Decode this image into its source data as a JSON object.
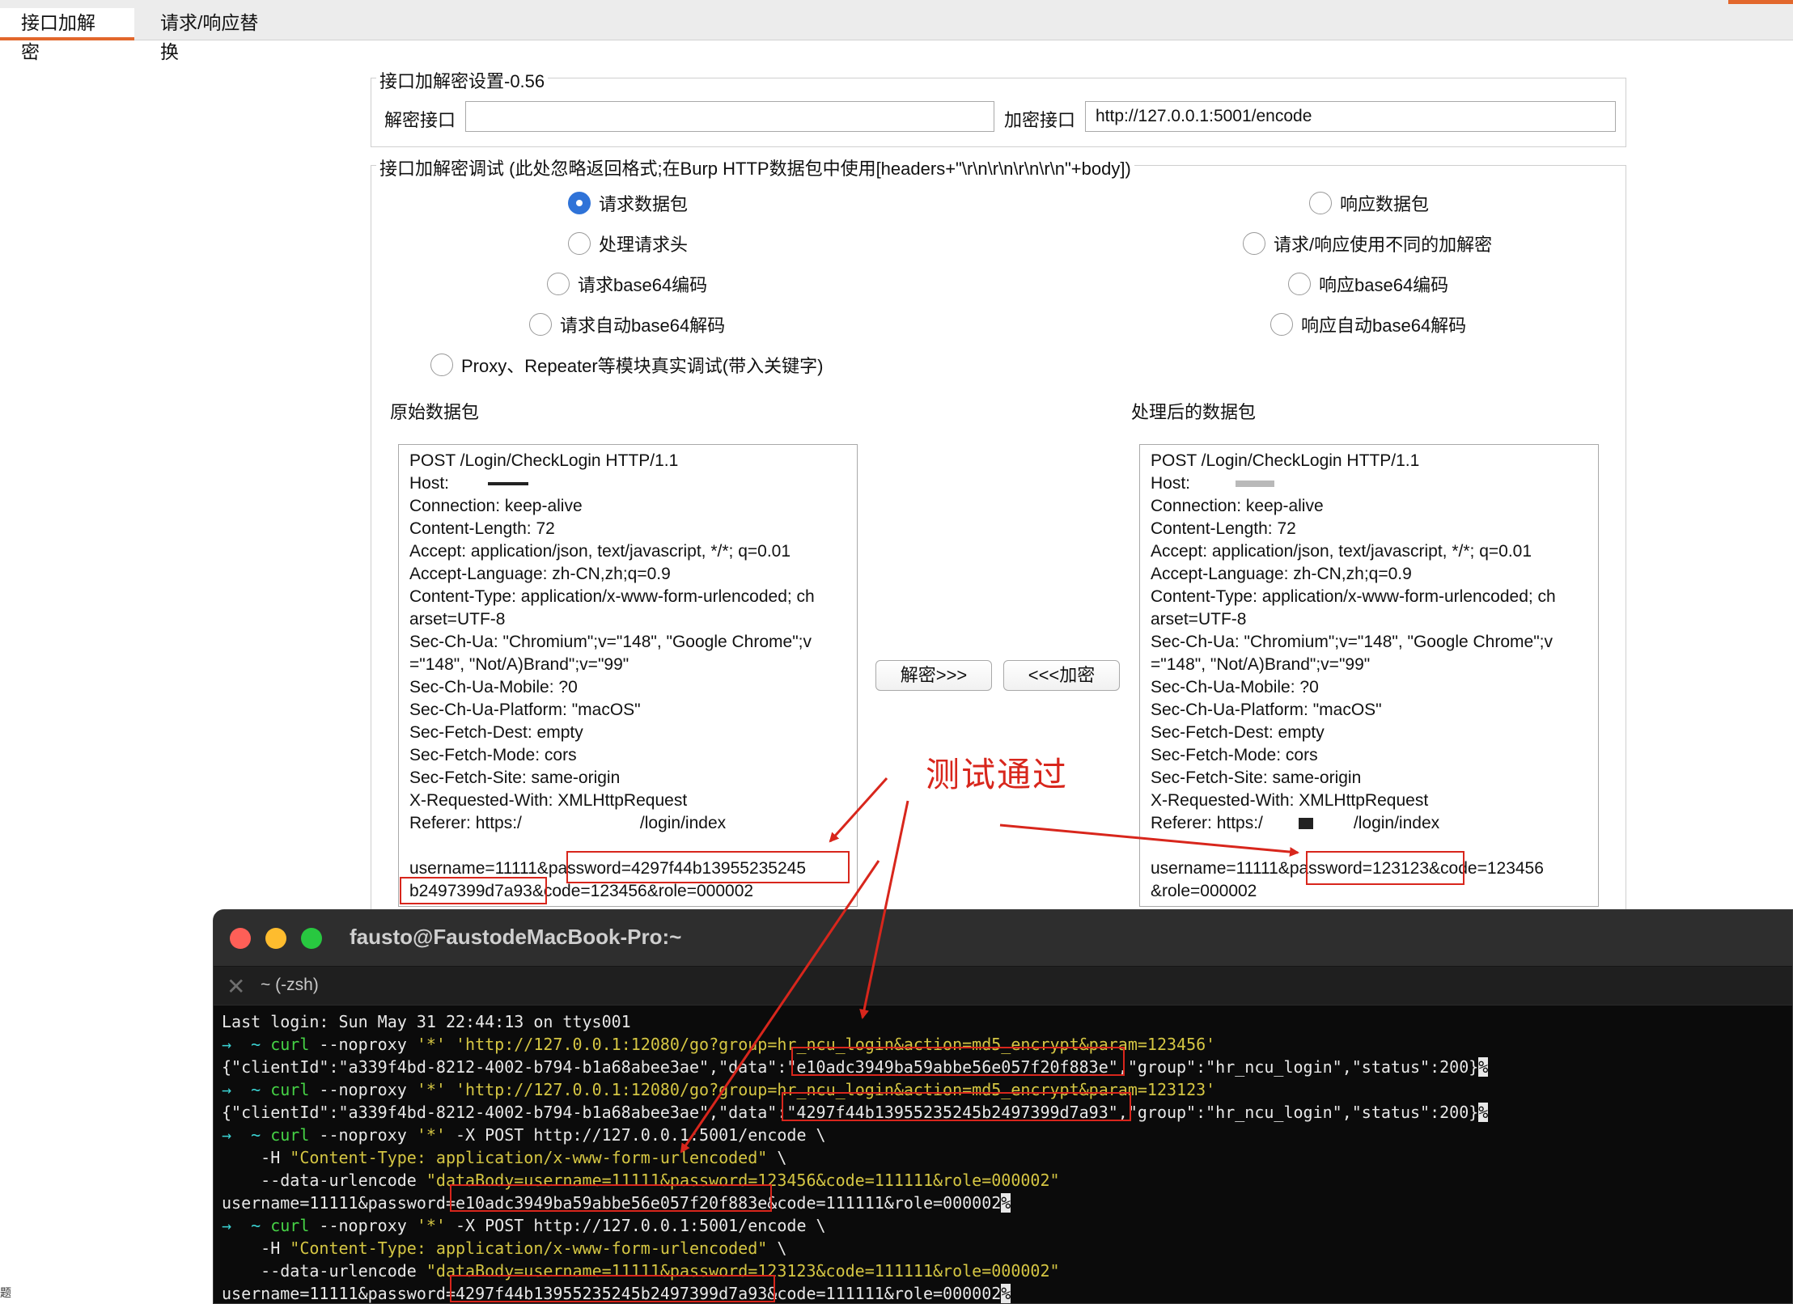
{
  "tabs": [
    {
      "label": "接口加解密",
      "active": true
    },
    {
      "label": "请求/响应替换",
      "active": false
    }
  ],
  "settings": {
    "legend": "接口加解密设置-0.56",
    "decrypt_label": "解密接口",
    "decrypt_value": "",
    "encrypt_label": "加密接口",
    "encrypt_value": "http://127.0.0.1:5001/encode"
  },
  "debug": {
    "legend": "接口加解密调试 (此处忽略返回格式;在Burp HTTP数据包中使用[headers+\"\\r\\n\\r\\n\\r\\n\\r\\n\"+body])",
    "left_radios": [
      {
        "label": "请求数据包",
        "checked": true
      },
      {
        "label": "处理请求头",
        "checked": false
      },
      {
        "label": "请求base64编码",
        "checked": false
      },
      {
        "label": "请求自动base64解码",
        "checked": false
      },
      {
        "label": "Proxy、Repeater等模块真实调试(带入关键字)",
        "checked": false
      }
    ],
    "right_radios": [
      {
        "label": "响应数据包",
        "checked": false
      },
      {
        "label": "请求/响应使用不同的加解密",
        "checked": false
      },
      {
        "label": "响应base64编码",
        "checked": false
      },
      {
        "label": "响应自动base64解码",
        "checked": false
      }
    ],
    "original_title": "原始数据包",
    "processed_title": "处理后的数据包",
    "decrypt_button": "解密>>>",
    "encrypt_button": "<<<加密"
  },
  "original_packet": [
    "POST /Login/CheckLogin HTTP/1.1",
    "Host:",
    "Connection: keep-alive",
    "Content-Length: 72",
    "Accept: application/json, text/javascript, */*; q=0.01",
    "Accept-Language: zh-CN,zh;q=0.9",
    "Content-Type: application/x-www-form-urlencoded; ch",
    "arset=UTF-8",
    "Sec-Ch-Ua: \"Chromium\";v=\"148\", \"Google Chrome\";v",
    "=\"148\", \"Not/A)Brand\";v=\"99\"",
    "Sec-Ch-Ua-Mobile: ?0",
    "Sec-Ch-Ua-Platform: \"macOS\"",
    "Sec-Fetch-Dest: empty",
    "Sec-Fetch-Mode: cors",
    "Sec-Fetch-Site: same-origin",
    "X-Requested-With: XMLHttpRequest",
    "Referer: https:/",
    "/login/index",
    "username=11111&password=4297f44b13955235245",
    "b2497399d7a93&code=123456&role=000002"
  ],
  "processed_packet": [
    "POST /Login/CheckLogin HTTP/1.1",
    "Host:",
    "Connection: keep-alive",
    "Content-Length: 72",
    "Accept: application/json, text/javascript, */*; q=0.01",
    "Accept-Language: zh-CN,zh;q=0.9",
    "Content-Type: application/x-www-form-urlencoded; ch",
    "arset=UTF-8",
    "Sec-Ch-Ua: \"Chromium\";v=\"148\", \"Google Chrome\";v",
    "=\"148\", \"Not/A)Brand\";v=\"99\"",
    "Sec-Ch-Ua-Mobile: ?0",
    "Sec-Ch-Ua-Platform: \"macOS\"",
    "Sec-Fetch-Dest: empty",
    "Sec-Fetch-Mode: cors",
    "Sec-Fetch-Site: same-origin",
    "X-Requested-With: XMLHttpRequest",
    "Referer: https:/",
    "/login/index",
    "username=11111&password=123123&code=123456",
    "&role=000002"
  ],
  "annotation": {
    "text": "测试通过",
    "color": "#d8261c"
  },
  "terminal": {
    "title": "fausto@FaustodeMacBook-Pro:~",
    "tab": "~ (-zsh)",
    "lines": [
      {
        "parts": [
          {
            "t": "Last login: Sun May 31 22:44:13 on ttys001",
            "c": "plain"
          }
        ]
      },
      {
        "parts": [
          {
            "t": "→  ~ ",
            "c": "arrow"
          },
          {
            "t": "curl",
            "c": "cmd"
          },
          {
            "t": " --noproxy ",
            "c": "plain"
          },
          {
            "t": "'*' 'http://127.0.0.1:12080/go?group=hr_ncu_login&action=md5_encrypt&param=123456'",
            "c": "str"
          }
        ]
      },
      {
        "parts": [
          {
            "t": "{\"clientId\":\"a339f4bd-8212-4002-b794-b1a68abee3ae\",\"data\":\"e10adc3949ba59abbe56e057f20f883e\",\"group\":\"hr_ncu_login\",\"status\":200}",
            "c": "plain"
          },
          {
            "t": "%",
            "c": "pct"
          }
        ]
      },
      {
        "parts": [
          {
            "t": "→  ~ ",
            "c": "arrow"
          },
          {
            "t": "curl",
            "c": "cmd"
          },
          {
            "t": " --noproxy ",
            "c": "plain"
          },
          {
            "t": "'*' 'http://127.0.0.1:12080/go?group=hr_ncu_login&action=md5_encrypt&param=123123'",
            "c": "str"
          }
        ]
      },
      {
        "parts": [
          {
            "t": "{\"clientId\":\"a339f4bd-8212-4002-b794-b1a68abee3ae\",\"data\":\"4297f44b13955235245b2497399d7a93\",\"group\":\"hr_ncu_login\",\"status\":200}",
            "c": "plain"
          },
          {
            "t": "%",
            "c": "pct"
          }
        ]
      },
      {
        "parts": [
          {
            "t": "→  ~ ",
            "c": "arrow"
          },
          {
            "t": "curl",
            "c": "cmd"
          },
          {
            "t": " --noproxy ",
            "c": "plain"
          },
          {
            "t": "'*'",
            "c": "str"
          },
          {
            "t": " -X POST http://127.0.0.1:5001/encode \\",
            "c": "plain"
          }
        ]
      },
      {
        "parts": [
          {
            "t": "    -H ",
            "c": "plain"
          },
          {
            "t": "\"Content-Type: application/x-www-form-urlencoded\"",
            "c": "str"
          },
          {
            "t": " \\",
            "c": "plain"
          }
        ]
      },
      {
        "parts": [
          {
            "t": "    --data-urlencode ",
            "c": "plain"
          },
          {
            "t": "\"dataBody=username=11111&password=123456&code=111111&role=000002\"",
            "c": "str"
          }
        ]
      },
      {
        "parts": [
          {
            "t": "username=11111&password=e10adc3949ba59abbe56e057f20f883e&code=111111&role=000002",
            "c": "plain"
          },
          {
            "t": "%",
            "c": "pct"
          }
        ]
      },
      {
        "parts": [
          {
            "t": "→  ~ ",
            "c": "arrow"
          },
          {
            "t": "curl",
            "c": "cmd"
          },
          {
            "t": " --noproxy ",
            "c": "plain"
          },
          {
            "t": "'*'",
            "c": "str"
          },
          {
            "t": " -X POST http://127.0.0.1:5001/encode \\",
            "c": "plain"
          }
        ]
      },
      {
        "parts": [
          {
            "t": "    -H ",
            "c": "plain"
          },
          {
            "t": "\"Content-Type: application/x-www-form-urlencoded\"",
            "c": "str"
          },
          {
            "t": " \\",
            "c": "plain"
          }
        ]
      },
      {
        "parts": [
          {
            "t": "    --data-urlencode ",
            "c": "plain"
          },
          {
            "t": "\"dataBody=username=11111&password=123123&code=111111&role=000002\"",
            "c": "str"
          }
        ]
      },
      {
        "parts": [
          {
            "t": "username=11111&password=4297f44b13955235245b2497399d7a93&code=111111&role=000002",
            "c": "plain"
          },
          {
            "t": "%",
            "c": "pct"
          }
        ]
      },
      {
        "parts": [
          {
            "t": "",
            "c": "plain"
          }
        ]
      }
    ]
  },
  "footer_hint": "题"
}
